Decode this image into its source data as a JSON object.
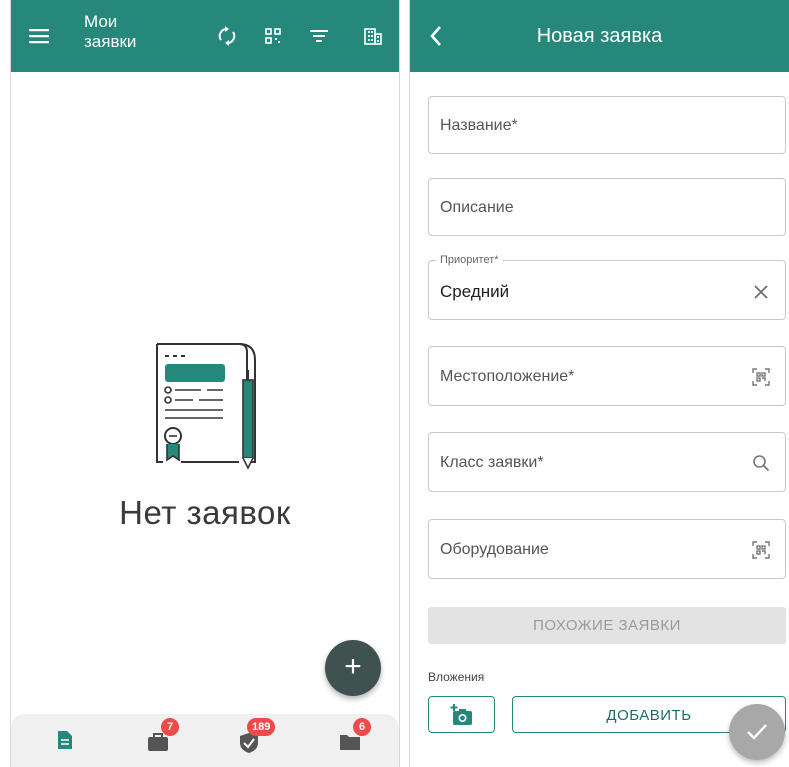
{
  "left_screen": {
    "title": "Мои\nзаявки",
    "title_line1": "Мои",
    "title_line2": "заявки",
    "empty_text": "Нет заявок",
    "bottom_nav": [
      {
        "icon": "document-icon",
        "badge": ""
      },
      {
        "icon": "briefcase-icon",
        "badge": "7"
      },
      {
        "icon": "shield-check-icon",
        "badge": "189"
      },
      {
        "icon": "folder-icon",
        "badge": "6"
      }
    ],
    "toolbar_icons": [
      "menu-icon",
      "sync-icon",
      "qr-scan-icon",
      "filter-icon",
      "building-icon"
    ]
  },
  "right_screen": {
    "title": "Новая заявка",
    "fields": {
      "name_placeholder": "Название*",
      "description_placeholder": "Описание",
      "priority_label": "Приоритет*",
      "priority_value": "Средний",
      "location_placeholder": "Местоположение*",
      "class_placeholder": "Класс заявки*",
      "equipment_placeholder": "Оборудование"
    },
    "similar_button": "ПОХОЖИЕ ЗАЯВКИ",
    "attachments_label": "Вложения",
    "add_button": "ДОБАВИТЬ"
  },
  "colors": {
    "primary": "#26887b",
    "fab_dark": "#3f5250",
    "badge": "#ef4a4a",
    "disabled": "#a8a8a8"
  }
}
